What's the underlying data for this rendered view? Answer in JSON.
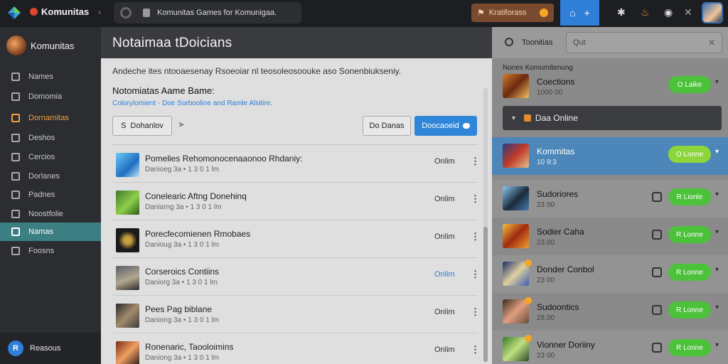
{
  "topbar": {
    "brand": "Komunitas",
    "address": "Komunitas Games for Komunigaa.",
    "promo": "Kratiforass",
    "plus": "+",
    "icons": [
      "logo-icon",
      "refresh-icon",
      "lock-icon",
      "notification-icon",
      "plus-icon",
      "bug-icon",
      "flame-icon",
      "record-icon",
      "close-icon",
      "profile-avatar"
    ]
  },
  "sidebar": {
    "title": "Komunitas",
    "items": [
      {
        "label": "Names",
        "icon": "names-icon"
      },
      {
        "label": "Domomia",
        "icon": "domain-icon"
      },
      {
        "label": "Dornarnitas",
        "icon": "community-icon"
      },
      {
        "label": "Deshos",
        "icon": "dashboard-icon"
      },
      {
        "label": "Cercios",
        "icon": "services-icon"
      },
      {
        "label": "Dorlanes",
        "icon": "lanes-icon"
      },
      {
        "label": "Padnes",
        "icon": "pad-icon"
      },
      {
        "label": "Noostfolie",
        "icon": "portfolio-icon"
      },
      {
        "label": "Namas",
        "icon": "names-alt-icon"
      },
      {
        "label": "Foosns",
        "icon": "forums-icon"
      }
    ],
    "footer_icon": "R",
    "footer_label": "Reasous"
  },
  "main": {
    "title": "Notaimaa tDoicians",
    "description": "Andeche ites ntooaesenay Rsoeoiar nl teosoleosoouke aso Sonenbiukseniy.",
    "subtitle": "Notomiatas Aame Bame:",
    "link": "Colorylomient - Doe Sorbooline and Ramle Alsitire.",
    "filter_label": "Dohanlov",
    "filter_icon": "S",
    "names_label": "Do Danas",
    "download_label": "Doocaoeid",
    "rows": [
      {
        "title": "Pomelies Rehomonocenaaonoo Rhdaniy:",
        "meta": "Danioeg 3a • 1 3 0 1 lm",
        "status": "Onlim",
        "blue": false,
        "thumb": "linear-gradient(135deg,#6ec8f5,#1f6fc0 60%,#bfe5fa)"
      },
      {
        "title": "Conelearic Aftng Donehinq",
        "meta": "Daniarng 3a • 1 3 0 1 lm",
        "status": "Onlim",
        "blue": false,
        "thumb": "linear-gradient(135deg,#3f7a2a,#8fcf4a 55%,#2d5a1c)"
      },
      {
        "title": "Porecfecomienen Rmobaes",
        "meta": "Danioug 3a • 1 3 0 1 lm",
        "status": "Onlim",
        "blue": false,
        "thumb": "radial-gradient(circle,#c9a040 20%,#1a1a1a 55%)"
      },
      {
        "title": "Corseroics Contiins",
        "meta": "Daniorg 3a • 1 3 0 1 lm",
        "status": "Onlim",
        "blue": true,
        "thumb": "linear-gradient(160deg,#5a5f6d,#b2a78e 55%,#2e2a2a)"
      },
      {
        "title": "Pees Pag biblane",
        "meta": "Daniong 3a • 1 3 0 1 lm",
        "status": "Onlim",
        "blue": false,
        "thumb": "linear-gradient(135deg,#2a2a2a,#a38b6c 50%,#3d3d3d)"
      },
      {
        "title": "Ronenaric, Taooloimins",
        "meta": "Daniong 3a • 1 3 0 1 lm",
        "status": "Onlim",
        "blue": false,
        "thumb": "linear-gradient(135deg,#7a2a1c,#f0a060 50%,#2a1a1a)"
      }
    ]
  },
  "right": {
    "search_label": "Toonitias",
    "search_placeholder": "Qut",
    "section_label": "Nones Komumitenung",
    "online_label": "Daa Online",
    "rows": [
      {
        "name": "Coections",
        "sub": "1000 00",
        "action": "O Laike",
        "chat": false,
        "highlight": false,
        "alt": false,
        "avatar": "linear-gradient(135deg,#d47a2e,#6b2a10 50%,#f5c060)"
      },
      {
        "name": "Kommitas",
        "sub": "10 9:3",
        "action": "O Lonne",
        "chat": false,
        "highlight": true,
        "alt": false,
        "avatar": "linear-gradient(135deg,#2a3c7a,#c03a2a 50%,#e6c08a)"
      },
      {
        "name": "Sudoriores",
        "sub": "23 00",
        "action": "R Lionle",
        "chat": true,
        "highlight": false,
        "alt": true,
        "avatar": "linear-gradient(135deg,#8ac8f0,#1a2a3a 55%,#4a7ab0)"
      },
      {
        "name": "Sodier Caha",
        "sub": "23.00",
        "action": "R Lonne",
        "chat": true,
        "highlight": false,
        "alt": false,
        "avatar": "linear-gradient(135deg,#f5c040,#a02a10 50%,#f0a030)"
      },
      {
        "name": "Donder Conbol",
        "sub": "23 00",
        "action": "R Lonne",
        "chat": true,
        "highlight": false,
        "alt": true,
        "avatar": "linear-gradient(135deg,#1a2a6a,#e0d0a0 50%,#3a5ab0)"
      },
      {
        "name": "Sudoontics",
        "sub": "28.00",
        "action": "R Lonne",
        "chat": true,
        "highlight": false,
        "alt": false,
        "avatar": "linear-gradient(135deg,#3a2a20,#e0a080 50%,#6a4a3a)"
      },
      {
        "name": "Vionner Doriiny",
        "sub": "23 00",
        "action": "R Lonne",
        "chat": true,
        "highlight": false,
        "alt": true,
        "avatar": "linear-gradient(135deg,#3a7a2a,#c0e080 50%,#2a4a2a)"
      }
    ]
  },
  "colors": {
    "accent_blue": "#2f7ed8",
    "online_green": "#4cc13a",
    "sidebar_selected": "#3c7f83",
    "orange": "#f0a040"
  }
}
